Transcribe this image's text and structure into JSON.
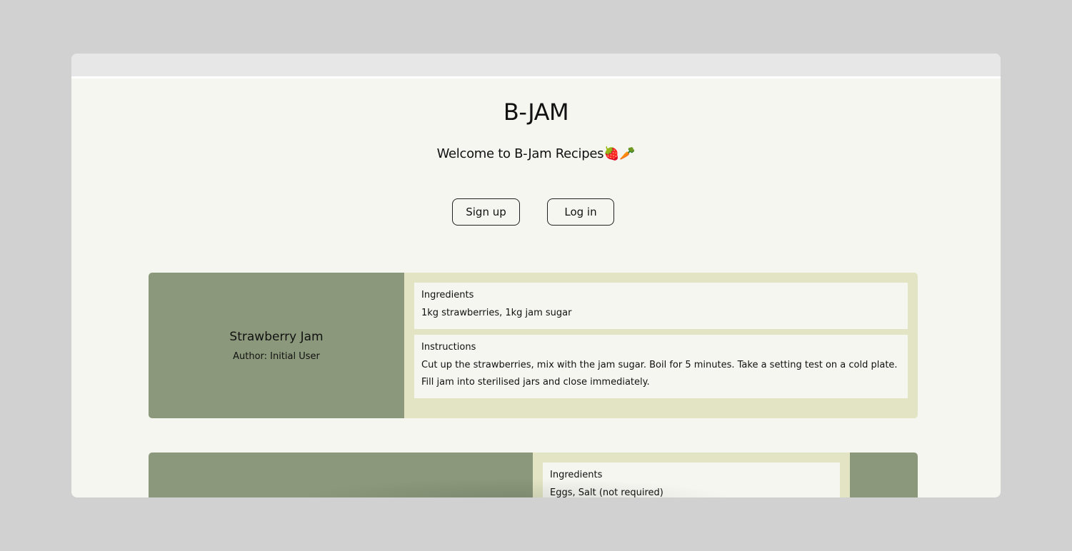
{
  "site": {
    "title": "B-JAM",
    "welcome": "Welcome to B-Jam Recipes🍓🥕"
  },
  "auth": {
    "signup_label": "Sign up",
    "login_label": "Log in"
  },
  "recipes": [
    {
      "title": "Strawberry Jam",
      "author": "Author: Initial User",
      "ingredients_heading": "Ingredients",
      "ingredients": "1kg strawberries, 1kg jam sugar",
      "instructions_heading": "Instructions",
      "instructions": "Cut up the strawberries, mix with the jam sugar. Boil for 5 minutes. Take a setting test on a cold plate. Fill jam into sterilised jars and close immediately."
    },
    {
      "ingredients_heading": "Ingredients",
      "ingredients": "Eggs, Salt (not required)"
    }
  ],
  "colors": {
    "page_bg": "#f5f6f0",
    "card_left": "#8b987b",
    "card_right": "#e2e4c4"
  }
}
